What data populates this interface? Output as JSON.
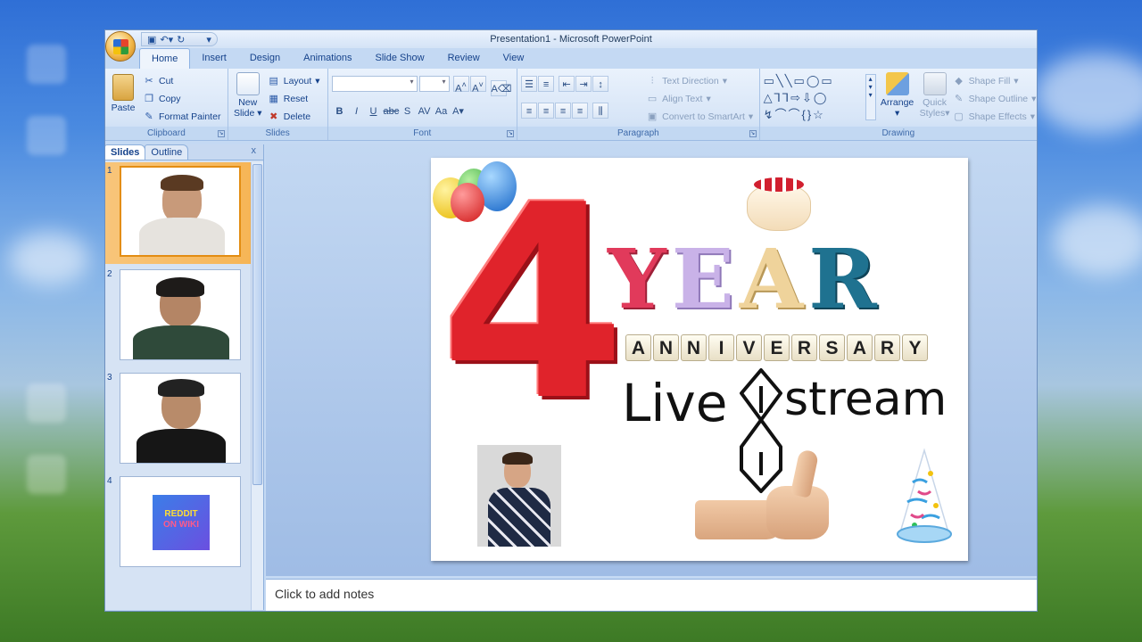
{
  "window": {
    "title": "Presentation1 - Microsoft PowerPoint"
  },
  "tabs": [
    {
      "label": "Home",
      "active": true
    },
    {
      "label": "Insert",
      "active": false
    },
    {
      "label": "Design",
      "active": false
    },
    {
      "label": "Animations",
      "active": false
    },
    {
      "label": "Slide Show",
      "active": false
    },
    {
      "label": "Review",
      "active": false
    },
    {
      "label": "View",
      "active": false
    }
  ],
  "ribbon": {
    "clipboard": {
      "label": "Clipboard",
      "paste": "Paste",
      "cut": "Cut",
      "copy": "Copy",
      "format_painter": "Format Painter"
    },
    "slides": {
      "label": "Slides",
      "new_slide_line1": "New",
      "new_slide_line2": "Slide",
      "layout": "Layout",
      "reset": "Reset",
      "delete": "Delete"
    },
    "font": {
      "label": "Font"
    },
    "paragraph": {
      "label": "Paragraph",
      "text_direction": "Text Direction",
      "align_text": "Align Text",
      "convert": "Convert to SmartArt"
    },
    "drawing": {
      "label": "Drawing",
      "arrange": "Arrange",
      "quick_styles_line1": "Quick",
      "quick_styles_line2": "Styles",
      "shape_fill": "Shape Fill",
      "shape_outline": "Shape Outline",
      "shape_effects": "Shape Effects"
    }
  },
  "pane": {
    "tab_slides": "Slides",
    "tab_outline": "Outline",
    "thumbnails": [
      {
        "num": "1",
        "selected": true
      },
      {
        "num": "2",
        "selected": false
      },
      {
        "num": "3",
        "selected": false
      },
      {
        "num": "4",
        "selected": false
      }
    ],
    "thumb4_logo_line1": "REDDIT",
    "thumb4_logo_line2": "ON WIKI"
  },
  "slide": {
    "number": "4",
    "word_year": [
      "Y",
      "E",
      "A",
      "R"
    ],
    "anniversary_tiles": [
      "A",
      "N",
      "N",
      "I",
      "V",
      "E",
      "R",
      "S",
      "A",
      "R",
      "Y"
    ],
    "live": "Live",
    "stream": "stream"
  },
  "notes": {
    "placeholder": "Click to add notes"
  },
  "colors": {
    "accent_orange": "#f6b556",
    "ribbon_blue": "#15428b"
  }
}
